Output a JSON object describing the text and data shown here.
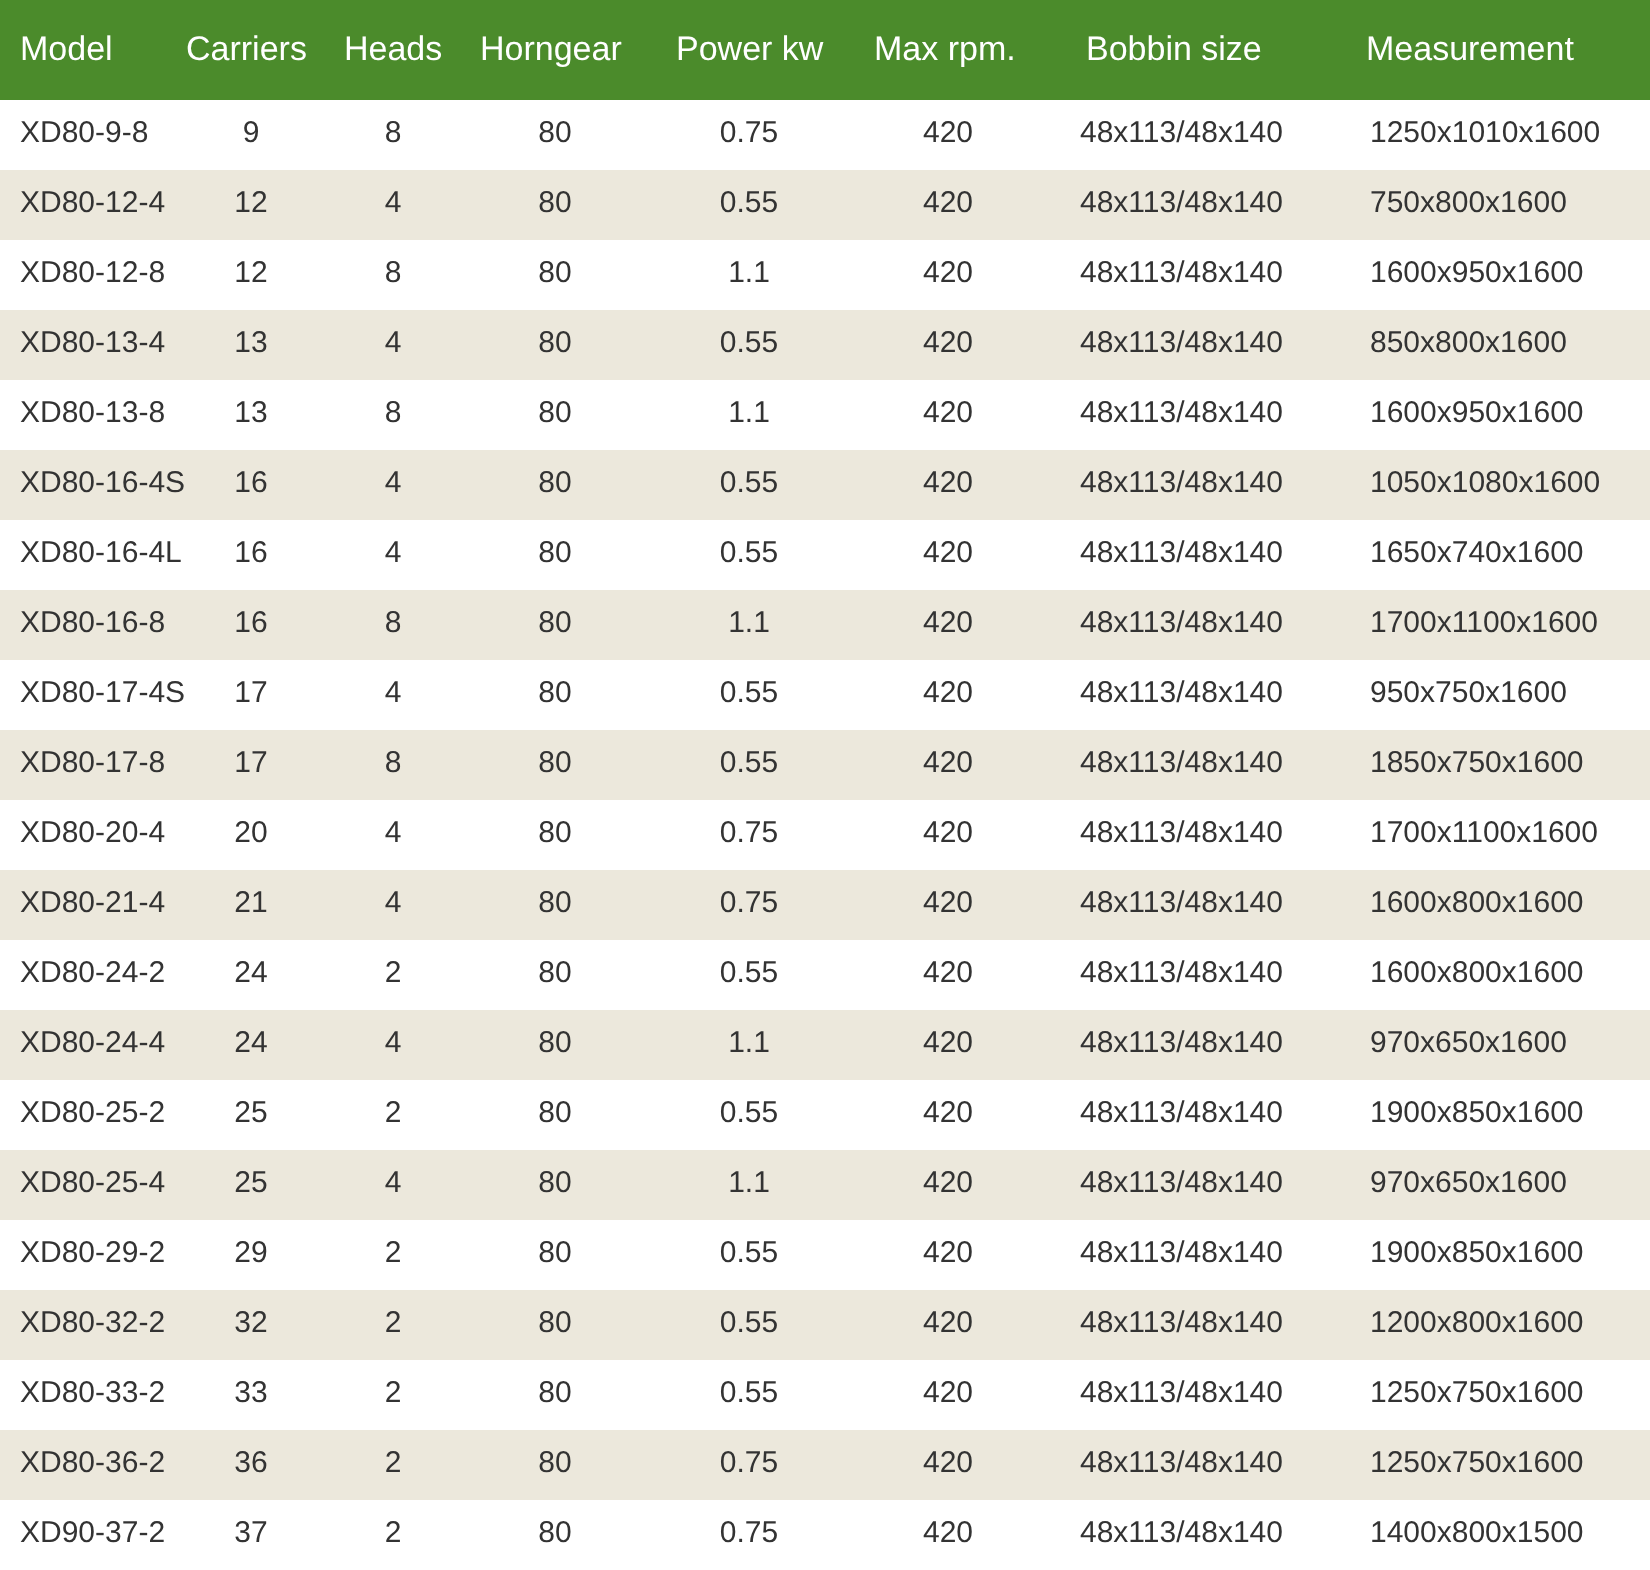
{
  "table": {
    "columns": [
      "Model",
      "Carriers",
      "Heads",
      "Horngear",
      "Power kw",
      "Max rpm.",
      "Bobbin size",
      "Measurement"
    ],
    "rows": [
      [
        "XD80-9-8",
        "9",
        "8",
        "80",
        "0.75",
        "420",
        "48x113/48x140",
        "1250x1010x1600"
      ],
      [
        "XD80-12-4",
        "12",
        "4",
        "80",
        "0.55",
        "420",
        "48x113/48x140",
        "750x800x1600"
      ],
      [
        "XD80-12-8",
        "12",
        "8",
        "80",
        "1.1",
        "420",
        "48x113/48x140",
        "1600x950x1600"
      ],
      [
        "XD80-13-4",
        "13",
        "4",
        "80",
        "0.55",
        "420",
        "48x113/48x140",
        "850x800x1600"
      ],
      [
        "XD80-13-8",
        "13",
        "8",
        "80",
        "1.1",
        "420",
        "48x113/48x140",
        "1600x950x1600"
      ],
      [
        "XD80-16-4S",
        "16",
        "4",
        "80",
        "0.55",
        "420",
        "48x113/48x140",
        "1050x1080x1600"
      ],
      [
        "XD80-16-4L",
        "16",
        "4",
        "80",
        "0.55",
        "420",
        "48x113/48x140",
        "1650x740x1600"
      ],
      [
        "XD80-16-8",
        "16",
        "8",
        "80",
        "1.1",
        "420",
        "48x113/48x140",
        "1700x1100x1600"
      ],
      [
        "XD80-17-4S",
        "17",
        "4",
        "80",
        "0.55",
        "420",
        "48x113/48x140",
        "950x750x1600"
      ],
      [
        "XD80-17-8",
        "17",
        "8",
        "80",
        "0.55",
        "420",
        "48x113/48x140",
        "1850x750x1600"
      ],
      [
        "XD80-20-4",
        "20",
        "4",
        "80",
        "0.75",
        "420",
        "48x113/48x140",
        "1700x1100x1600"
      ],
      [
        "XD80-21-4",
        "21",
        "4",
        "80",
        "0.75",
        "420",
        "48x113/48x140",
        "1600x800x1600"
      ],
      [
        "XD80-24-2",
        "24",
        "2",
        "80",
        "0.55",
        "420",
        "48x113/48x140",
        "1600x800x1600"
      ],
      [
        "XD80-24-4",
        "24",
        "4",
        "80",
        "1.1",
        "420",
        "48x113/48x140",
        "970x650x1600"
      ],
      [
        "XD80-25-2",
        "25",
        "2",
        "80",
        "0.55",
        "420",
        "48x113/48x140",
        "1900x850x1600"
      ],
      [
        "XD80-25-4",
        "25",
        "4",
        "80",
        "1.1",
        "420",
        "48x113/48x140",
        "970x650x1600"
      ],
      [
        "XD80-29-2",
        "29",
        "2",
        "80",
        "0.55",
        "420",
        "48x113/48x140",
        "1900x850x1600"
      ],
      [
        "XD80-32-2",
        "32",
        "2",
        "80",
        "0.55",
        "420",
        "48x113/48x140",
        "1200x800x1600"
      ],
      [
        "XD80-33-2",
        "33",
        "2",
        "80",
        "0.55",
        "420",
        "48x113/48x140",
        "1250x750x1600"
      ],
      [
        "XD80-36-2",
        "36",
        "2",
        "80",
        "0.75",
        "420",
        "48x113/48x140",
        "1250x750x1600"
      ],
      [
        "XD90-37-2",
        "37",
        "2",
        "80",
        "0.75",
        "420",
        "48x113/48x140",
        "1400x800x1500"
      ]
    ]
  }
}
